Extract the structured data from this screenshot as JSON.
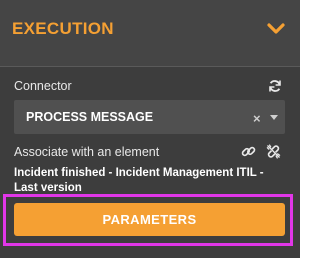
{
  "header": {
    "title": "EXECUTION",
    "chevron_icon": "chevron-down-icon"
  },
  "connector": {
    "label": "Connector",
    "refresh_icon": "refresh-icon",
    "selected_value": "PROCESS MESSAGE",
    "clear_symbol": "×"
  },
  "association": {
    "label": "Associate with an element",
    "link_icon": "link-icon",
    "unlink_icon": "unlink-icon",
    "description": "Incident finished - Incident Management ITIL - Last version"
  },
  "parameters_button": {
    "label": "PARAMETERS"
  },
  "colors": {
    "accent": "#f5a033",
    "panel_bg": "#3d3d3d",
    "header_bg": "#454545",
    "select_bg": "#505050",
    "highlight": "#e036e8"
  }
}
